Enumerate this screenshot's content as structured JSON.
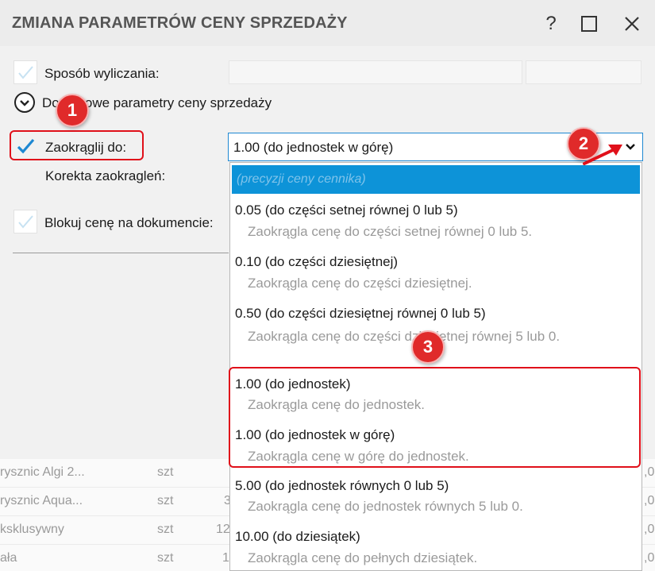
{
  "window": {
    "title": "ZMIANA PARAMETRÓW CENY SPRZEDAŻY",
    "help_glyph": "?"
  },
  "form": {
    "sposob_label": "Sposób wyliczania:",
    "dodatkowe_label": "Dodatkowe parametry ceny sprzedaży",
    "zaokraglij_label": "Zaokrąglij do:",
    "zaokraglij_value": "1.00 (do jednostek w górę)",
    "korekta_label": "Korekta zaokragleń:",
    "blokuj_label": "Blokuj cenę na dokumencie:"
  },
  "dropdown": {
    "selected_placeholder": "(precyzji ceny cennika)",
    "options": [
      {
        "title": "0.05 (do części setnej równej 0 lub 5)",
        "desc": "Zaokrągla cenę do części setnej równej 0 lub 5."
      },
      {
        "title": "0.10 (do części dziesiętnej)",
        "desc": "Zaokrągla cenę do części dziesiętnej."
      },
      {
        "title": "0.50 (do części dziesiętnej równej 0 lub 5)",
        "desc": "Zaokrągla cenę do części dziesiętnej równej 5 lub 0."
      },
      {
        "title": "1.00 (do jednostek)",
        "desc": "Zaokrągla cenę do jednostek."
      },
      {
        "title": "1.00 (do jednostek w górę)",
        "desc": "Zaokrągla cenę w górę do jednostek."
      },
      {
        "title": "5.00 (do jednostek równych 0 lub 5)",
        "desc": "Zaokrągla cenę do jednostek równych 5 lub 0."
      },
      {
        "title": "10.00 (do dziesiątek)",
        "desc": "Zaokrągla cenę do pełnych dziesiątek."
      }
    ]
  },
  "grid": {
    "rows": [
      {
        "name": "rysznic Algi 2...",
        "unit": "szt",
        "qty": "",
        "right": ",0"
      },
      {
        "name": "rysznic Aqua...",
        "unit": "szt",
        "qty": "3",
        "right": ",0"
      },
      {
        "name": "ksklusywny",
        "unit": "szt",
        "qty": "12",
        "right": ",0"
      },
      {
        "name": "ała",
        "unit": "szt",
        "qty": "1",
        "right": ",0"
      }
    ]
  },
  "annotations": {
    "badge1": "1",
    "badge2": "2",
    "badge3": "3"
  },
  "colors": {
    "selection": "#0d93d8",
    "highlight": "#e0101a",
    "checkmark": "#1e88d2"
  }
}
